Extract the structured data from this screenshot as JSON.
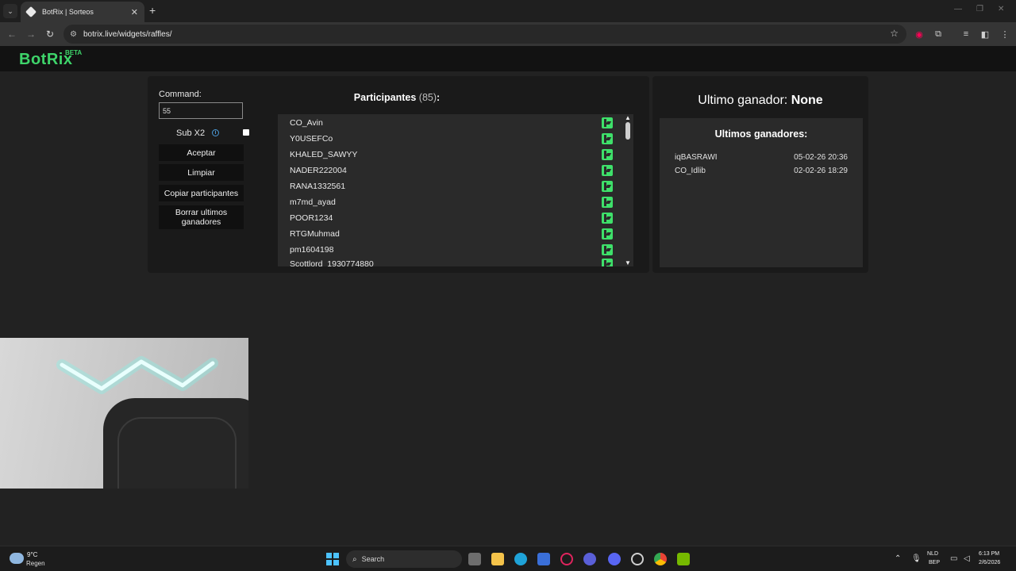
{
  "browser": {
    "tab_title": "BotRix | Sorteos",
    "url": "botrix.live/widgets/raffles/"
  },
  "site": {
    "logo": "BotRix",
    "logo_badge": "BETA"
  },
  "raffle": {
    "command_label": "Command:",
    "command_value": "55",
    "sub_label": "Sub X2",
    "sub_checked": false,
    "buttons": {
      "accept": "Aceptar",
      "clear": "Limpiar",
      "copy": "Copiar participantes",
      "delete": "Borrar ultimos ganadores"
    },
    "participants_label": "Participantes",
    "participants_count": "(85)",
    "participants_colon": ":",
    "participants": [
      "CO_Avin",
      "Y0USEFCo",
      "KHALED_SAWYY",
      "NADER222004",
      "RANA1332561",
      "m7md_ayad",
      "POOR1234",
      "RTGMuhmad",
      "pm1604198",
      "Scottlord_1930774880"
    ]
  },
  "winners": {
    "last_winner_label": "Ultimo ganador:",
    "last_winner_value": "None",
    "history_title": "Ultimos ganadores:",
    "history": [
      {
        "name": "iqBASRAWI",
        "date": "05-02-26 20:36"
      },
      {
        "name": "CO_Idlib",
        "date": "02-02-26 18:29"
      }
    ]
  },
  "taskbar": {
    "temperature": "9°C",
    "weather": "Regen",
    "search_placeholder": "Search",
    "lang_top": "NLD",
    "lang_bottom": "BEP",
    "time": "6:13 PM",
    "date": "2/6/2026"
  },
  "colors": {
    "brand": "#3ed46a",
    "kick": "#3ee06a",
    "info": "#4a9ad8"
  }
}
